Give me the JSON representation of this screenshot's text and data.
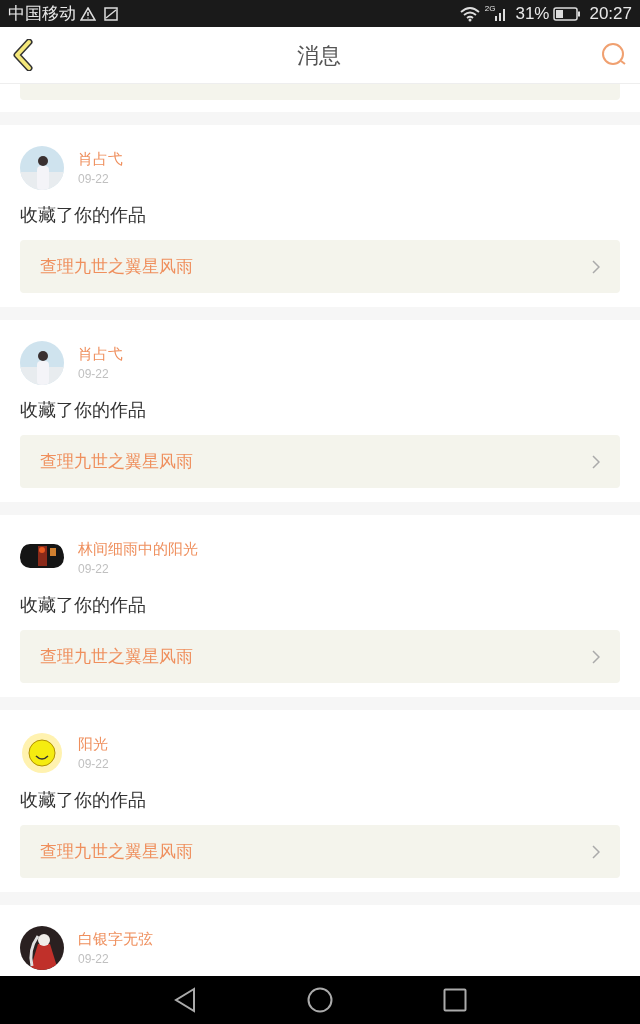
{
  "status_bar": {
    "carrier": "中国移动",
    "network": "2G",
    "battery": "31%",
    "time": "20:27"
  },
  "header": {
    "title": "消息"
  },
  "messages": [
    {
      "user": "肖占弋",
      "date": "09-22",
      "action": "收藏了你的作品",
      "work": "查理九世之翼星风雨"
    },
    {
      "user": "肖占弋",
      "date": "09-22",
      "action": "收藏了你的作品",
      "work": "查理九世之翼星风雨"
    },
    {
      "user": "林间细雨中的阳光",
      "date": "09-22",
      "action": "收藏了你的作品",
      "work": "查理九世之翼星风雨"
    },
    {
      "user": "阳光",
      "date": "09-22",
      "action": "收藏了你的作品",
      "work": "查理九世之翼星风雨"
    },
    {
      "user": "白银字无弦",
      "date": "09-22"
    }
  ]
}
